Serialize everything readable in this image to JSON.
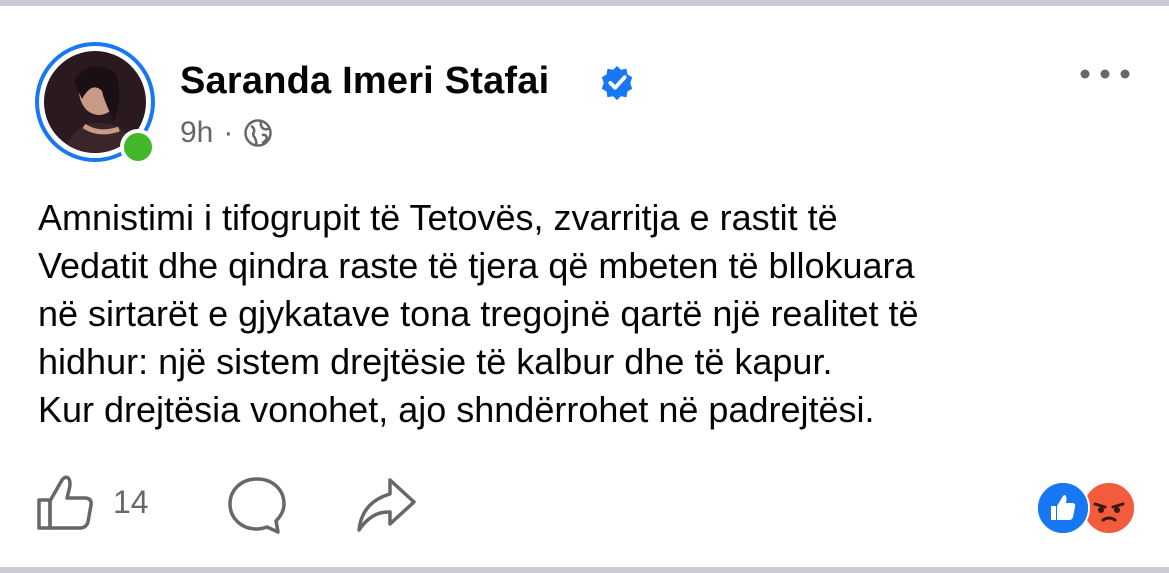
{
  "post": {
    "author": "Saranda Imeri Stafai",
    "verified": true,
    "time": "9h",
    "separator": "·",
    "audience_icon": "globe-icon",
    "more_icon": "more-horizontal-icon",
    "body_lines": [
      "Amnistimi i tifogrupit të Tetovës, zvarritja e rastit të",
      "Vedatit dhe qindra raste të tjera që mbeten të bllokuara",
      "në sirtarët e gjykatave tona tregojnë qartë një realitet të",
      "hidhur: një sistem drejtësie të kalbur dhe të kapur.",
      "Kur drejtësia vonohet, ajo shndërrohet në padrejtësi."
    ],
    "like_count": "14",
    "reactions": [
      "like",
      "angry"
    ],
    "colors": {
      "brand_blue": "#1877f2",
      "online_green": "#42b72a",
      "secondary_text": "#65676b",
      "angry_orange": "#f7714c"
    }
  }
}
